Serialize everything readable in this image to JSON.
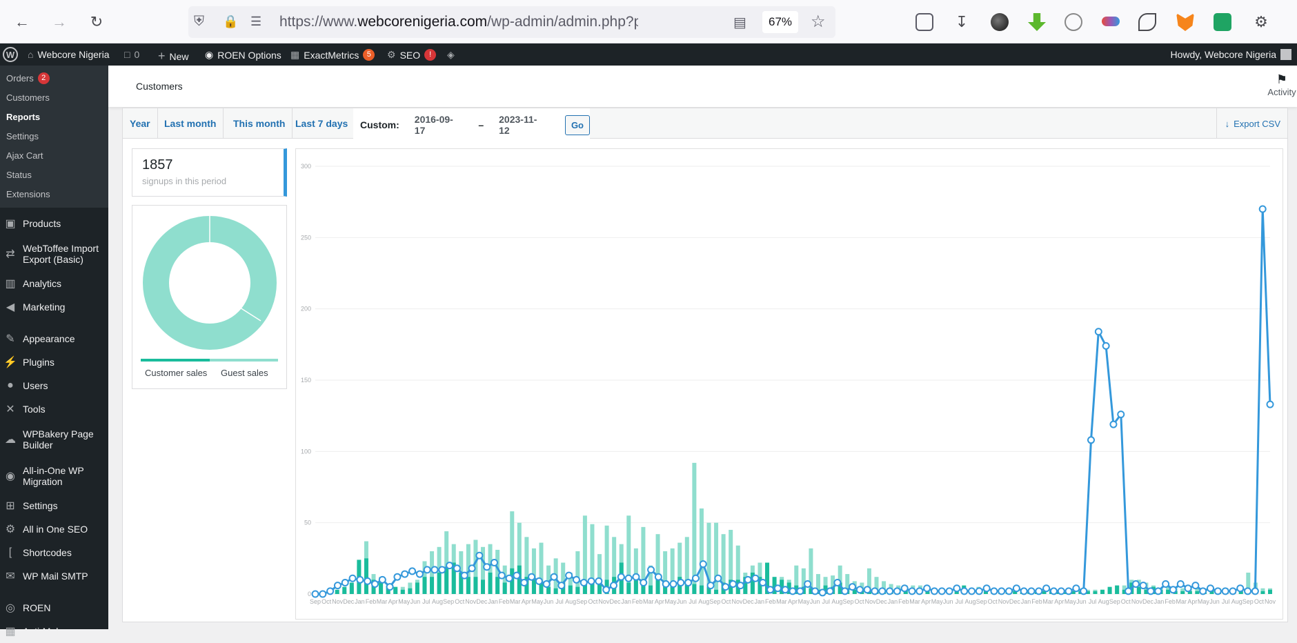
{
  "browser": {
    "url_prefix": "https://www.",
    "url_domain": "webcorenigeria.com",
    "url_path": "/wp-admin/admin.php?page=wc-repo",
    "zoom": "67%"
  },
  "adminbar": {
    "site": "Webcore Nigeria",
    "comments": "0",
    "new": "New",
    "roen": "ROEN Options",
    "exactmetrics": "ExactMetrics",
    "exactmetrics_count": "5",
    "seo": "SEO",
    "seo_count": "!",
    "howdy": "Howdy, Webcore Nigeria"
  },
  "sidebar": {
    "submenu": [
      {
        "label": "Orders",
        "badge": "2"
      },
      {
        "label": "Customers"
      },
      {
        "label": "Reports"
      },
      {
        "label": "Settings"
      },
      {
        "label": "Ajax Cart"
      },
      {
        "label": "Status"
      },
      {
        "label": "Extensions"
      }
    ],
    "menu": [
      {
        "label": "Products",
        "icon": "archive-icon"
      },
      {
        "label": "WebToffee Import Export (Basic)",
        "icon": "import-export-icon"
      },
      {
        "label": "Analytics",
        "icon": "bar-chart-icon"
      },
      {
        "label": "Marketing",
        "icon": "megaphone-icon"
      },
      {
        "label": "Appearance",
        "icon": "paintbrush-icon"
      },
      {
        "label": "Plugins",
        "icon": "plugin-icon"
      },
      {
        "label": "Users",
        "icon": "user-icon"
      },
      {
        "label": "Tools",
        "icon": "wrench-icon"
      },
      {
        "label": "WPBakery Page Builder",
        "icon": "cloud-icon"
      },
      {
        "label": "All-in-One WP Migration",
        "icon": "migration-icon"
      },
      {
        "label": "Settings",
        "icon": "settings-icon"
      },
      {
        "label": "All in One SEO",
        "icon": "seo-icon"
      },
      {
        "label": "Shortcodes",
        "icon": "brackets-icon"
      },
      {
        "label": "WP Mail SMTP",
        "icon": "mail-icon"
      },
      {
        "label": "ROEN",
        "icon": "circle-icon"
      },
      {
        "label": "Anti-Malware",
        "icon": "shield-icon"
      }
    ]
  },
  "header": {
    "title": "Customers",
    "activity": "Activity"
  },
  "report": {
    "tabs": [
      "Year",
      "Last month",
      "This month",
      "Last 7 days"
    ],
    "custom_label": "Custom:",
    "date_from": "2016-09-17",
    "date_sep": "–",
    "date_to": "2023-11-12",
    "go": "Go",
    "export": "Export CSV",
    "stat_value": "1857",
    "stat_label": "signups in this period",
    "legend": [
      "Customer sales",
      "Guest sales"
    ],
    "colors": {
      "customer": "#1abc9c",
      "guest": "#8fdece",
      "line": "#3498db"
    }
  },
  "chart_data": {
    "type": "bar",
    "ylim": [
      0,
      300
    ],
    "yticks": [
      "0",
      "50",
      "100",
      "150",
      "200",
      "250",
      "300"
    ],
    "categories": [
      "Sep",
      "Oct",
      "Nov",
      "Dec",
      "Jan",
      "Feb",
      "Mar",
      "Apr",
      "May",
      "Jun",
      "Jul",
      "Aug",
      "Sep",
      "Oct",
      "Nov",
      "Dec",
      "Jan",
      "Feb",
      "Mar",
      "Apr",
      "May",
      "Jun",
      "Jul",
      "Aug",
      "Sep",
      "Oct",
      "Nov",
      "Dec",
      "Jan",
      "Feb",
      "Mar",
      "Apr",
      "May",
      "Jun",
      "Jul",
      "Aug",
      "Sep",
      "Oct",
      "Nov",
      "Dec",
      "Jan",
      "Feb",
      "Mar",
      "Apr",
      "May",
      "Jun",
      "Jul",
      "Aug",
      "Sep",
      "Oct",
      "Nov",
      "Dec",
      "Jan",
      "Feb",
      "Mar",
      "Apr",
      "May",
      "Jun",
      "Jul",
      "Aug",
      "Sep",
      "Oct",
      "Nov",
      "Dec",
      "Jan",
      "Feb",
      "Mar",
      "Apr",
      "May",
      "Jun",
      "Jul",
      "Aug",
      "Sep",
      "Oct",
      "Nov",
      "Dec",
      "Jan",
      "Feb",
      "Mar",
      "Apr",
      "May",
      "Jun",
      "Jul",
      "Aug",
      "Sep",
      "Oct",
      "Nov"
    ],
    "series": [
      {
        "name": "Customer sales",
        "kind": "bar",
        "values": [
          0,
          0,
          0,
          3,
          5,
          8,
          24,
          25,
          10,
          8,
          6,
          5,
          3,
          4,
          8,
          12,
          12,
          15,
          18,
          22,
          15,
          12,
          12,
          10,
          15,
          12,
          8,
          18,
          20,
          12,
          10,
          8,
          5,
          4,
          8,
          6,
          5,
          7,
          10,
          8,
          10,
          12,
          22,
          8,
          10,
          8,
          6,
          10,
          9,
          8,
          12,
          10,
          7,
          6,
          5,
          3,
          8,
          10,
          10,
          12,
          15,
          12,
          22,
          12,
          10,
          8,
          6,
          5,
          4,
          3,
          6,
          5,
          8,
          4,
          3,
          3,
          2,
          2,
          2,
          2,
          2,
          3,
          2,
          2,
          3,
          2,
          2,
          3,
          2,
          6,
          2,
          3,
          2,
          2,
          2,
          2,
          2,
          2,
          2,
          2,
          2,
          2,
          2,
          2,
          2,
          2,
          2,
          2,
          3,
          5,
          6,
          3,
          8,
          5,
          3,
          5,
          3,
          3,
          2,
          2,
          2,
          2,
          2,
          3,
          2,
          3,
          2,
          2,
          2,
          2,
          2,
          3
        ]
      },
      {
        "name": "Guest sales",
        "kind": "bar",
        "values": [
          0,
          0,
          0,
          1,
          2,
          5,
          20,
          37,
          14,
          12,
          6,
          4,
          5,
          8,
          10,
          23,
          30,
          33,
          44,
          35,
          30,
          35,
          38,
          33,
          35,
          31,
          20,
          58,
          50,
          40,
          32,
          36,
          20,
          25,
          22,
          15,
          30,
          55,
          49,
          28,
          48,
          40,
          35,
          55,
          32,
          47,
          20,
          42,
          30,
          32,
          36,
          40,
          92,
          60,
          50,
          50,
          42,
          45,
          34,
          15,
          20,
          22,
          12,
          6,
          12,
          10,
          20,
          18,
          32,
          14,
          12,
          13,
          20,
          14,
          9,
          8,
          18,
          12,
          9,
          7,
          6,
          6,
          6,
          6,
          5,
          4,
          4,
          4,
          4,
          5,
          3,
          5,
          3,
          3,
          3,
          3,
          3,
          3,
          3,
          3,
          3,
          3,
          3,
          3,
          3,
          3,
          3,
          3,
          3,
          4,
          6,
          6,
          10,
          10,
          8,
          6,
          4,
          6,
          4,
          4,
          4,
          5,
          4,
          4,
          4,
          4,
          3,
          5,
          15,
          8,
          4,
          4
        ]
      },
      {
        "name": "Signups",
        "kind": "line",
        "values": [
          0,
          0,
          2,
          6,
          8,
          11,
          10,
          9,
          7,
          10,
          5,
          12,
          14,
          16,
          14,
          17,
          17,
          17,
          20,
          18,
          13,
          18,
          27,
          19,
          22,
          13,
          11,
          13,
          8,
          12,
          9,
          7,
          12,
          6,
          13,
          10,
          8,
          9,
          9,
          3,
          6,
          12,
          11,
          12,
          8,
          17,
          12,
          7,
          7,
          8,
          8,
          11,
          21,
          6,
          11,
          5,
          7,
          6,
          10,
          11,
          8,
          3,
          4,
          3,
          2,
          2,
          7,
          2,
          1,
          2,
          8,
          2,
          5,
          3,
          3,
          2,
          2,
          2,
          2,
          4,
          2,
          2,
          4,
          2,
          2,
          2,
          4,
          2,
          2,
          2,
          4,
          2,
          2,
          2,
          4,
          2,
          2,
          2,
          4,
          2,
          2,
          2,
          4,
          2,
          108,
          184,
          174,
          119,
          126,
          2,
          7,
          6,
          2,
          2,
          7,
          3,
          7,
          4,
          6,
          2,
          4,
          2,
          2,
          2,
          4,
          2,
          2,
          270,
          133
        ]
      }
    ]
  }
}
